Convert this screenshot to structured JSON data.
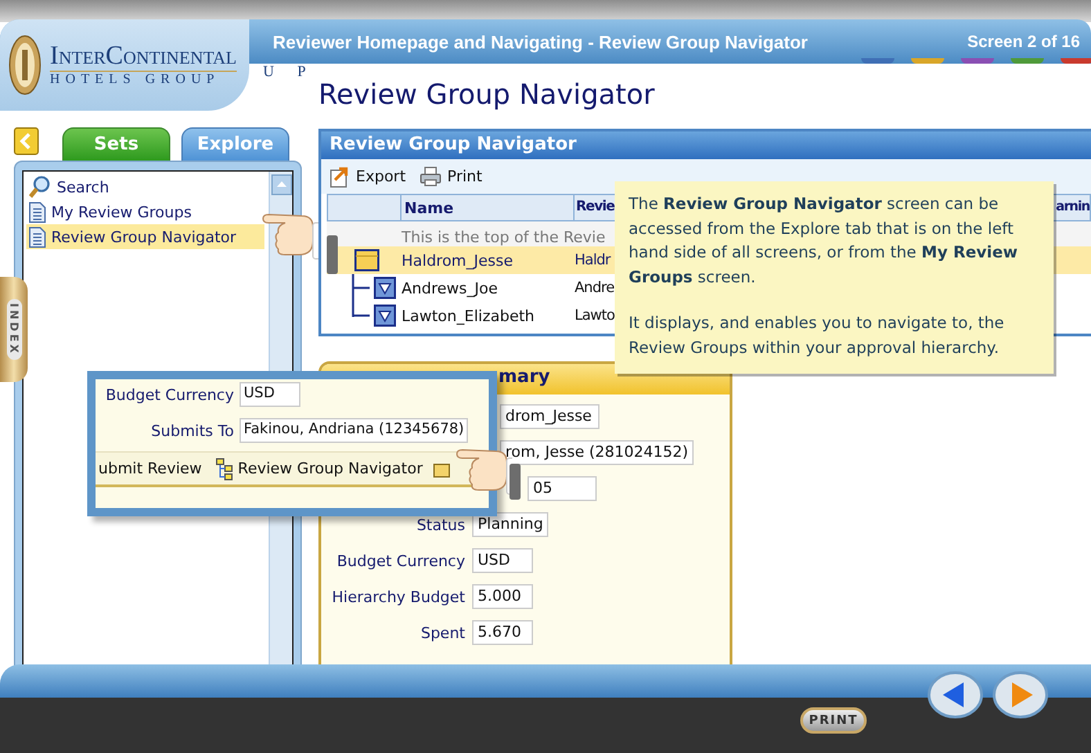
{
  "header": {
    "logo_line1": "InterContinental",
    "logo_line2": "HOTELS GROUP",
    "logo_ghost": "U P",
    "title": "Reviewer Homepage and Navigating - Review Group Navigator",
    "screen_counter": "Screen 2 of 16",
    "color_tabs": [
      {
        "color": "#3f6fb5"
      },
      {
        "color": "#d9a629"
      },
      {
        "color": "#8a4fb3"
      },
      {
        "color": "#4f9a3a"
      },
      {
        "color": "#c93a2e"
      }
    ]
  },
  "page_title": "Review Group Navigator",
  "sidebar": {
    "tabs": [
      {
        "label": "Sets",
        "selected": false
      },
      {
        "label": "Explore",
        "selected": true
      }
    ],
    "items": [
      {
        "label": "Search",
        "kind": "search",
        "selected": false
      },
      {
        "label": "My Review Groups",
        "kind": "page",
        "selected": false
      },
      {
        "label": "Review Group Navigator",
        "kind": "page",
        "selected": true
      }
    ],
    "index_tab": "INDEX"
  },
  "navigator": {
    "title": "Review Group Navigator",
    "toolbar": [
      {
        "label": "Export",
        "kind": "export"
      },
      {
        "label": "Print",
        "kind": "print"
      }
    ],
    "columns": [
      "Name",
      "Revie",
      "arnin"
    ],
    "info_row": "This is the top of the Revie",
    "rows": [
      {
        "name": "Haldrom_Jesse",
        "reviewer": "Haldr",
        "selected": true,
        "expanded": true,
        "children": [
          {
            "name": "Andrews_Joe",
            "reviewer": "Andre",
            "selected": false,
            "expanded": false
          },
          {
            "name": "Lawton_Elizabeth",
            "reviewer": "Lawto",
            "selected": false,
            "expanded": false
          }
        ]
      }
    ]
  },
  "callout": {
    "paragraphs": [
      "The **Review Group Navigator** screen can be accessed from the Explore tab that is on the left hand side of all screens, or from the **My Review Groups** screen.",
      "It displays, and enables you to navigate to, the Review Groups within your approval hierarchy."
    ]
  },
  "summary": {
    "title": "mary",
    "fields": [
      {
        "value": "drom_Jesse"
      },
      {
        "value": "rom, Jesse (281024152)"
      },
      {
        "value": "05"
      },
      {
        "label": "Status",
        "value": "Planning"
      },
      {
        "label": "Budget Currency",
        "value": "USD"
      },
      {
        "label": "Hierarchy Budget",
        "value": "5.000"
      },
      {
        "label": "Spent",
        "value": "5.670"
      }
    ]
  },
  "inset": {
    "fields": [
      {
        "label": "Budget Currency",
        "value": "USD"
      },
      {
        "label": "Submits To",
        "value": "Fakinou, Andriana (12345678)"
      }
    ],
    "toolbar": [
      {
        "label": "ubmit Review",
        "kind": "text"
      },
      {
        "label": "Review Group Navigator",
        "kind": "hierarchy"
      }
    ]
  },
  "footer": {
    "print": "PRINT"
  }
}
